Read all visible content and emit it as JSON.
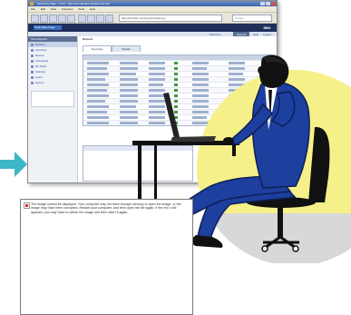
{
  "browser": {
    "title": "Reporting Page – Tivoli · Tab of the Medium Entitlement Info",
    "menu": [
      "File",
      "Edit",
      "View",
      "Favorites",
      "Tools",
      "Help"
    ],
    "address": "http://tivoli.ibm.com/reports/index.jsp",
    "search_placeholder": "Google"
  },
  "app": {
    "logo_text": "Tivoli Base Page",
    "brand": "IBM.",
    "sublinks": [
      "Welcome",
      "Help",
      "Logout"
    ],
    "active_tab": "Reports"
  },
  "nav": {
    "header": "View Reports",
    "items": [
      "Reports",
      "Favorites",
      "Recent",
      "Scheduled",
      "My Tasks",
      "Settings",
      "Users",
      "Export"
    ]
  },
  "main": {
    "title": "Reports",
    "tabs": [
      "Summary",
      "Details"
    ]
  },
  "broken_image": {
    "message": "The image cannot be displayed. Your computer may not have enough memory to open the image, or the image may have been corrupted. Restart your computer, and then open the file again. If the red x still appears, you may have to delete the image and then insert it again."
  },
  "colors": {
    "arrow": "#3bb6c7",
    "circle": "#f6f08a",
    "suit": "#1d3f9e",
    "floor": "#d8d8d8"
  }
}
